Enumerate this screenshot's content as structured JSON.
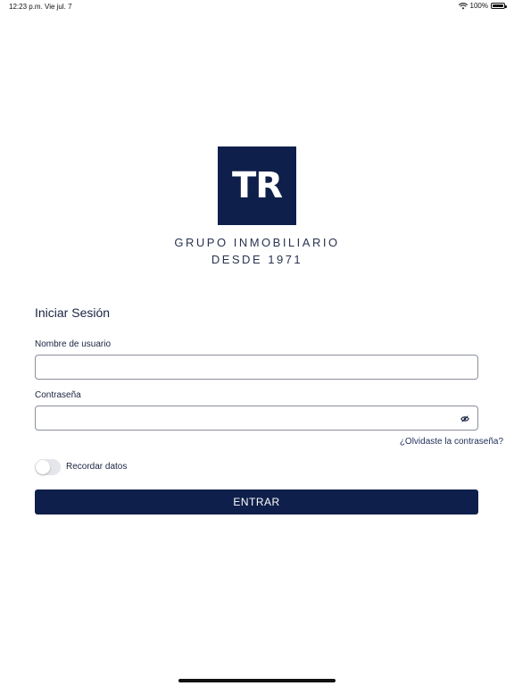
{
  "status_bar": {
    "time": "12:23 p.m.",
    "date": "Vie jul. 7",
    "battery": "100%",
    "battery_level": 1.0,
    "wifi_icon": "wifi-icon"
  },
  "brand": {
    "logo_text": "TR",
    "line1": "GRUPO INMOBILIARIO",
    "line2": "DESDE 1971",
    "primary_color": "#0f1f4b"
  },
  "login": {
    "title": "Iniciar Sesión",
    "username_label": "Nombre de usuario",
    "username_value": "",
    "password_label": "Contraseña",
    "password_value": "",
    "show_password_icon": "eye-icon",
    "forgot_link": "¿Olvidaste la contraseña?",
    "remember_label": "Recordar datos",
    "remember_on": false,
    "submit_label": "ENTRAR"
  }
}
